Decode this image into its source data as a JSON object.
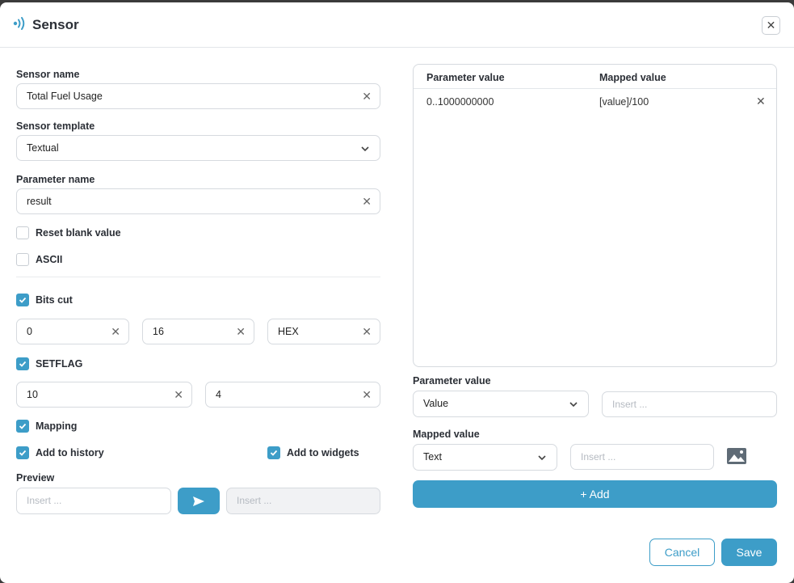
{
  "header": {
    "title": "Sensor"
  },
  "form": {
    "sensor_name": {
      "label": "Sensor name",
      "value": "Total Fuel Usage"
    },
    "sensor_template": {
      "label": "Sensor template",
      "value": "Textual"
    },
    "parameter_name": {
      "label": "Parameter name",
      "value": "result"
    },
    "reset_blank_value": {
      "label": "Reset blank value",
      "checked": false
    },
    "ascii": {
      "label": "ASCII",
      "checked": false
    },
    "bits_cut": {
      "label": "Bits cut",
      "checked": true,
      "from": "0",
      "to": "16",
      "format": "HEX"
    },
    "setflag": {
      "label": "SETFLAG",
      "checked": true,
      "v1": "10",
      "v2": "4"
    },
    "mapping": {
      "label": "Mapping",
      "checked": true
    },
    "add_to_history": {
      "label": "Add to history",
      "checked": true
    },
    "add_to_widgets": {
      "label": "Add to widgets",
      "checked": true
    },
    "preview": {
      "label": "Preview",
      "input_placeholder": "Insert ...",
      "output_placeholder": "Insert ..."
    }
  },
  "mapping_table": {
    "columns": [
      "Parameter value",
      "Mapped value"
    ],
    "rows": [
      {
        "parameter": "0..1000000000",
        "mapped": "[value]/100"
      }
    ]
  },
  "mapping_editor": {
    "parameter_value": {
      "label": "Parameter value",
      "type": "Value",
      "placeholder": "Insert ..."
    },
    "mapped_value": {
      "label": "Mapped value",
      "type": "Text",
      "placeholder": "Insert ..."
    },
    "add_label": "+ Add"
  },
  "footer": {
    "cancel_label": "Cancel",
    "save_label": "Save"
  },
  "colors": {
    "accent": "#3d9dc8"
  },
  "icons": {
    "header": "signal-icon",
    "close": "close-icon",
    "send": "send-icon",
    "image": "image-icon"
  }
}
